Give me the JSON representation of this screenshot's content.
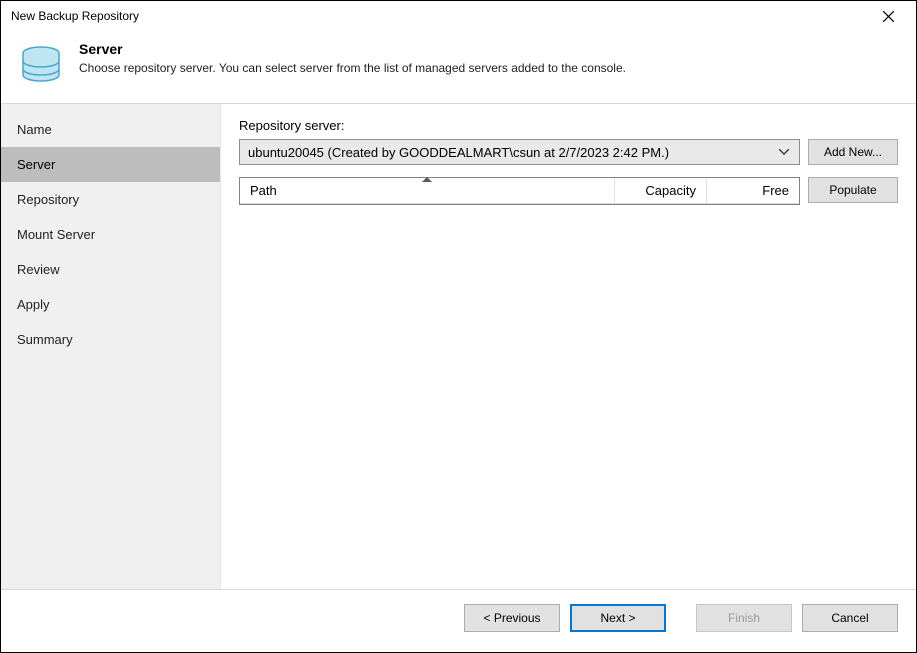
{
  "window": {
    "title": "New Backup Repository"
  },
  "header": {
    "title": "Server",
    "description": "Choose repository server. You can select server from the list of managed servers added to the console."
  },
  "sidebar": {
    "items": [
      {
        "label": "Name",
        "active": false
      },
      {
        "label": "Server",
        "active": true
      },
      {
        "label": "Repository",
        "active": false
      },
      {
        "label": "Mount Server",
        "active": false
      },
      {
        "label": "Review",
        "active": false
      },
      {
        "label": "Apply",
        "active": false
      },
      {
        "label": "Summary",
        "active": false
      }
    ]
  },
  "main": {
    "server_label": "Repository server:",
    "server_select": {
      "selected": "ubuntu20045 (Created by GOODDEALMART\\csun at 2/7/2023 2:42 PM.)"
    },
    "add_new_label": "Add New...",
    "populate_label": "Populate",
    "table": {
      "columns": {
        "path": "Path",
        "capacity": "Capacity",
        "free": "Free"
      },
      "rows": []
    }
  },
  "footer": {
    "previous": "< Previous",
    "next": "Next >",
    "finish": "Finish",
    "cancel": "Cancel"
  }
}
